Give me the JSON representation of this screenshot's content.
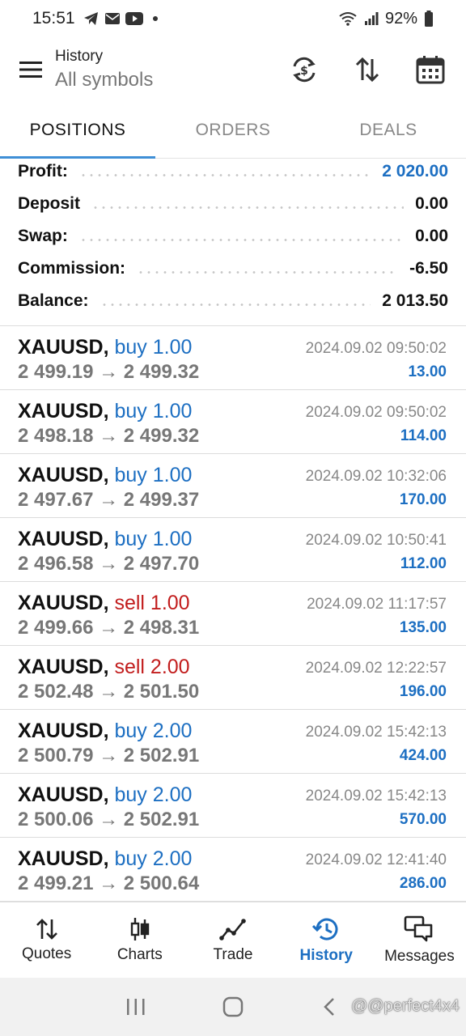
{
  "status_bar": {
    "time": "15:51",
    "battery": "92%",
    "notification_icons": [
      "telegram-icon",
      "mail-icon",
      "youtube-icon",
      "dot-icon"
    ],
    "system_icons": [
      "wifi-icon",
      "signal-icon",
      "battery-icon"
    ]
  },
  "header": {
    "title": "History",
    "subtitle": "All symbols",
    "actions": [
      "currency-refresh-icon",
      "sort-icon",
      "calendar-icon"
    ]
  },
  "tabs": [
    {
      "label": "POSITIONS",
      "active": true
    },
    {
      "label": "ORDERS",
      "active": false
    },
    {
      "label": "DEALS",
      "active": false
    }
  ],
  "summary": [
    {
      "label": "Profit:",
      "value": "2 020.00",
      "accent": "#1d6fc2"
    },
    {
      "label": "Deposit",
      "value": "0.00"
    },
    {
      "label": "Swap:",
      "value": "0.00"
    },
    {
      "label": "Commission:",
      "value": "-6.50"
    },
    {
      "label": "Balance:",
      "value": "2 013.50"
    }
  ],
  "deals": [
    {
      "symbol": "XAUUSD,",
      "side": "buy 1.00",
      "type": "buy",
      "open": "2 499.19",
      "arrow": "→",
      "close": "2 499.32",
      "time": "2024.09.02 09:50:02",
      "profit": "13.00"
    },
    {
      "symbol": "XAUUSD,",
      "side": "buy 1.00",
      "type": "buy",
      "open": "2 498.18",
      "arrow": "→",
      "close": "2 499.32",
      "time": "2024.09.02 09:50:02",
      "profit": "114.00"
    },
    {
      "symbol": "XAUUSD,",
      "side": "buy 1.00",
      "type": "buy",
      "open": "2 497.67",
      "arrow": "→",
      "close": "2 499.37",
      "time": "2024.09.02 10:32:06",
      "profit": "170.00"
    },
    {
      "symbol": "XAUUSD,",
      "side": "buy 1.00",
      "type": "buy",
      "open": "2 496.58",
      "arrow": "→",
      "close": "2 497.70",
      "time": "2024.09.02 10:50:41",
      "profit": "112.00"
    },
    {
      "symbol": "XAUUSD,",
      "side": "sell 1.00",
      "type": "sell",
      "open": "2 499.66",
      "arrow": "→",
      "close": "2 498.31",
      "time": "2024.09.02 11:17:57",
      "profit": "135.00"
    },
    {
      "symbol": "XAUUSD,",
      "side": "sell 2.00",
      "type": "sell",
      "open": "2 502.48",
      "arrow": "→",
      "close": "2 501.50",
      "time": "2024.09.02 12:22:57",
      "profit": "196.00"
    },
    {
      "symbol": "XAUUSD,",
      "side": "buy 2.00",
      "type": "buy",
      "open": "2 500.79",
      "arrow": "→",
      "close": "2 502.91",
      "time": "2024.09.02 15:42:13",
      "profit": "424.00"
    },
    {
      "symbol": "XAUUSD,",
      "side": "buy 2.00",
      "type": "buy",
      "open": "2 500.06",
      "arrow": "→",
      "close": "2 502.91",
      "time": "2024.09.02 15:42:13",
      "profit": "570.00"
    },
    {
      "symbol": "XAUUSD,",
      "side": "buy 2.00",
      "type": "buy",
      "open": "2 499.21",
      "arrow": "→",
      "close": "2 500.64",
      "time": "2024.09.02 12:41:40",
      "profit": "286.00"
    }
  ],
  "bottom_nav": [
    {
      "label": "Quotes",
      "icon": "quotes-icon",
      "active": false
    },
    {
      "label": "Charts",
      "icon": "candles-icon",
      "active": false
    },
    {
      "label": "Trade",
      "icon": "trade-icon",
      "active": false
    },
    {
      "label": "History",
      "icon": "history-icon",
      "active": true
    },
    {
      "label": "Messages",
      "icon": "messages-icon",
      "active": false
    }
  ],
  "system_nav": [
    "recents-icon",
    "home-icon",
    "back-icon"
  ],
  "watermark": "@@perfect4x4",
  "colors": {
    "accent": "#1d6fc2",
    "sell": "#c21d1d",
    "tab_indicator": "#3f8fd6"
  }
}
